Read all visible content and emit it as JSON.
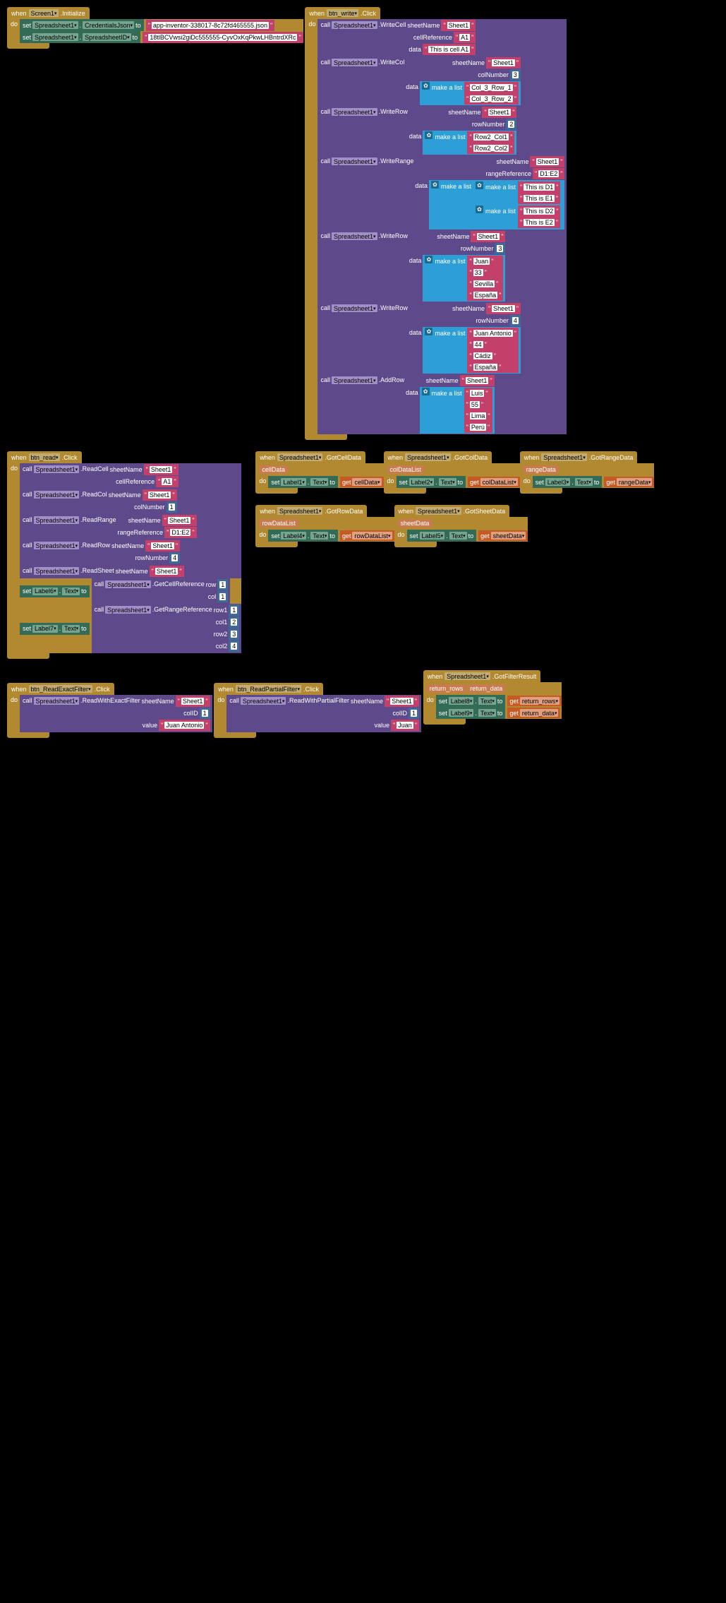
{
  "screen_init": {
    "when": "when",
    "component": "Screen1",
    "event": ".Initialize",
    "do": "do",
    "set1": {
      "set": "set",
      "comp": "Spreadsheet1",
      "prop": "CredentialsJson",
      "to": "to",
      "val": "app-inventor-338017-8c72fd465555.json"
    },
    "set2": {
      "set": "set",
      "comp": "Spreadsheet1",
      "prop": "SpreadsheetID",
      "to": "to",
      "val": "18tlBCVwsi2giDc555555-CyvOxKqPkwLHBntrdXRc"
    }
  },
  "btn_write": {
    "when": "when",
    "component": "btn_write",
    "event": ".Click",
    "do": "do",
    "call": "call",
    "makelist": "make a list",
    "m1": {
      "comp": "Spreadsheet1",
      "method": ".WriteCell",
      "p": [
        [
          "sheetName",
          "Sheet1"
        ],
        [
          "cellReference",
          "A1"
        ],
        [
          "data",
          "This is cell A1"
        ]
      ]
    },
    "m2": {
      "comp": "Spreadsheet1",
      "method": ".WriteCol",
      "p": [
        [
          "sheetName",
          "Sheet1"
        ],
        [
          "colNumber",
          "3"
        ]
      ],
      "data_label": "data",
      "list": [
        "Col_3_Row_1",
        "Col_3_Row_2"
      ]
    },
    "m3": {
      "comp": "Spreadsheet1",
      "method": ".WriteRow",
      "p": [
        [
          "sheetName",
          "Sheet1"
        ],
        [
          "rowNumber",
          "2"
        ]
      ],
      "data_label": "data",
      "list": [
        "Row2_Col1",
        "Row2_Col2"
      ]
    },
    "m4": {
      "comp": "Spreadsheet1",
      "method": ".WriteRange",
      "p": [
        [
          "sheetName",
          "Sheet1"
        ],
        [
          "rangeReference",
          "D1:E2"
        ]
      ],
      "data_label": "data",
      "nested": [
        [
          "This is D1",
          "This is E1"
        ],
        [
          "This is D2",
          "This is E2"
        ]
      ]
    },
    "m5": {
      "comp": "Spreadsheet1",
      "method": ".WriteRow",
      "p": [
        [
          "sheetName",
          "Sheet1"
        ],
        [
          "rowNumber",
          "3"
        ]
      ],
      "data_label": "data",
      "list": [
        "Juan",
        "33",
        "Sevilla",
        "España"
      ]
    },
    "m6": {
      "comp": "Spreadsheet1",
      "method": ".WriteRow",
      "p": [
        [
          "sheetName",
          "Sheet1"
        ],
        [
          "rowNumber",
          "4"
        ]
      ],
      "data_label": "data",
      "list": [
        "Juan Antonio",
        "44",
        "Cádiz",
        "España"
      ]
    },
    "m7": {
      "comp": "Spreadsheet1",
      "method": ".AddRow",
      "sheetName": "sheetName",
      "sheet": "Sheet1",
      "data_label": "data",
      "list": [
        "Luis",
        "55",
        "Lima",
        "Perú"
      ]
    }
  },
  "btn_read": {
    "when": "when",
    "component": "btn_read",
    "event": ".Click",
    "do": "do",
    "call": "call",
    "set": "set",
    "to": "to",
    "text": "Text",
    "r1": {
      "comp": "Spreadsheet1",
      "method": ".ReadCell",
      "p": [
        [
          "sheetName",
          "Sheet1"
        ],
        [
          "cellReference",
          "A1"
        ]
      ]
    },
    "r2": {
      "comp": "Spreadsheet1",
      "method": ".ReadCol",
      "p": [
        [
          "sheetName",
          "Sheet1"
        ],
        [
          "colNumber",
          "1"
        ]
      ]
    },
    "r3": {
      "comp": "Spreadsheet1",
      "method": ".ReadRange",
      "p": [
        [
          "sheetName",
          "Sheet1"
        ],
        [
          "rangeReference",
          "D1:E2"
        ]
      ]
    },
    "r4": {
      "comp": "Spreadsheet1",
      "method": ".ReadRow",
      "p": [
        [
          "sheetName",
          "Sheet1"
        ],
        [
          "rowNumber",
          "4"
        ]
      ]
    },
    "r5": {
      "comp": "Spreadsheet1",
      "method": ".ReadSheet",
      "p": [
        [
          "sheetName",
          "Sheet1"
        ]
      ]
    },
    "s6": {
      "label": "Label6",
      "call_comp": "Spreadsheet1",
      "call_method": ".GetCellReference",
      "p": [
        [
          "row",
          "1"
        ],
        [
          "col",
          "1"
        ]
      ]
    },
    "s7": {
      "label": "Label7",
      "call_comp": "Spreadsheet1",
      "call_method": ".GetRangeReference",
      "p": [
        [
          "row1",
          "1"
        ],
        [
          "col1",
          "2"
        ],
        [
          "row2",
          "3"
        ],
        [
          "col2",
          "4"
        ]
      ]
    }
  },
  "exact": {
    "when": "when",
    "component": "btn_ReadExactFilter",
    "event": ".Click",
    "do": "do",
    "call": "call",
    "comp": "Spreadsheet1",
    "method": ".ReadWithExactFilter",
    "p": [
      [
        "sheetName",
        "Sheet1"
      ],
      [
        "colID",
        "1"
      ],
      [
        "value",
        "Juan Antonio"
      ]
    ]
  },
  "partial": {
    "when": "when",
    "component": "btn_ReadPartialFilter",
    "event": ".Click",
    "do": "do",
    "call": "call",
    "comp": "Spreadsheet1",
    "method": ".ReadWithPartialFilter",
    "p": [
      [
        "sheetName",
        "Sheet1"
      ],
      [
        "colID",
        "1"
      ],
      [
        "value",
        "Juan"
      ]
    ]
  },
  "got_filter": {
    "when": "when",
    "component": "Spreadsheet1",
    "event": ".GotFilterResult",
    "do": "do",
    "set": "set",
    "to": "to",
    "text": "Text",
    "get": "get",
    "vars": [
      "return_rows",
      "return_data"
    ],
    "sets": [
      {
        "label": "Label8",
        "var": "return_rows"
      },
      {
        "label": "Label9",
        "var": "return_data"
      }
    ]
  },
  "evt": [
    {
      "ev": ".GotCellData",
      "var": "cellData",
      "label": "Label1"
    },
    {
      "ev": ".GotColData",
      "var": "colDataList",
      "label": "Label2"
    },
    {
      "ev": ".GotRangeData",
      "var": "rangeData",
      "label": "Label3"
    },
    {
      "ev": ".GotRowData",
      "var": "rowDataList",
      "label": "Label4"
    },
    {
      "ev": ".GotSheetData",
      "var": "sheetData",
      "label": "Label5"
    }
  ],
  "common": {
    "when": "when",
    "do": "do",
    "set": "set",
    "to": "to",
    "text": "Text",
    "get": "get",
    "ss": "Spreadsheet1"
  }
}
